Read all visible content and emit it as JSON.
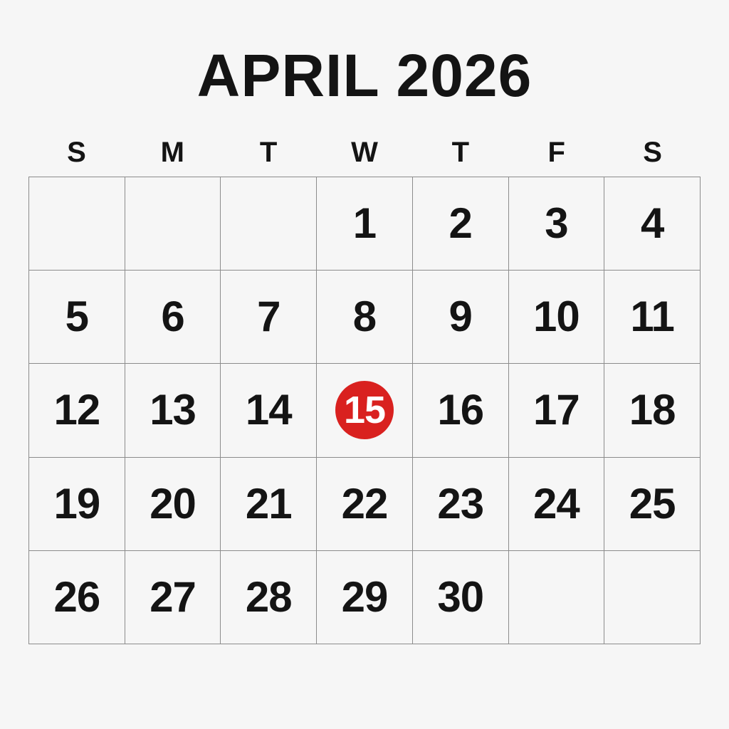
{
  "calendar": {
    "title": "APRIL 2026",
    "weekdays": [
      "S",
      "M",
      "T",
      "W",
      "T",
      "F",
      "S"
    ],
    "weeks": [
      [
        "",
        "",
        "",
        "1",
        "2",
        "3",
        "4"
      ],
      [
        "5",
        "6",
        "7",
        "8",
        "9",
        "10",
        "11"
      ],
      [
        "12",
        "13",
        "14",
        "15",
        "16",
        "17",
        "18"
      ],
      [
        "19",
        "20",
        "21",
        "22",
        "23",
        "24",
        "25"
      ],
      [
        "26",
        "27",
        "28",
        "29",
        "30",
        "",
        ""
      ]
    ],
    "highlighted_day": "15",
    "colors": {
      "background": "#f6f6f6",
      "text": "#141414",
      "grid_line": "#8c8c8c",
      "highlight": "#d9211f",
      "highlight_text": "#ffffff"
    }
  }
}
